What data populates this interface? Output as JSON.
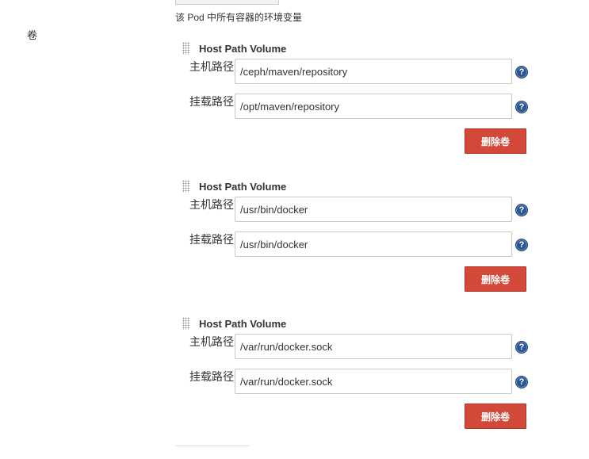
{
  "env_note": "该 Pod 中所有容器的环境变量",
  "section_label": "卷",
  "volumes": [
    {
      "title": "Host Path Volume",
      "host_label": "主机路径",
      "host_value": "/ceph/maven/repository",
      "mount_label": "挂载路径",
      "mount_value": "/opt/maven/repository",
      "delete_label": "删除卷"
    },
    {
      "title": "Host Path Volume",
      "host_label": "主机路径",
      "host_value": "/usr/bin/docker",
      "mount_label": "挂载路径",
      "mount_value": "/usr/bin/docker",
      "delete_label": "删除卷"
    },
    {
      "title": "Host Path Volume",
      "host_label": "主机路径",
      "host_value": "/var/run/docker.sock",
      "mount_label": "挂载路径",
      "mount_value": "/var/run/docker.sock",
      "delete_label": "删除卷"
    }
  ],
  "help_glyph": "?",
  "icons": {
    "help": "help-icon",
    "drag": "drag-handle-icon"
  },
  "colors": {
    "delete_button": "#d24939",
    "help_icon": "#2a5593"
  }
}
